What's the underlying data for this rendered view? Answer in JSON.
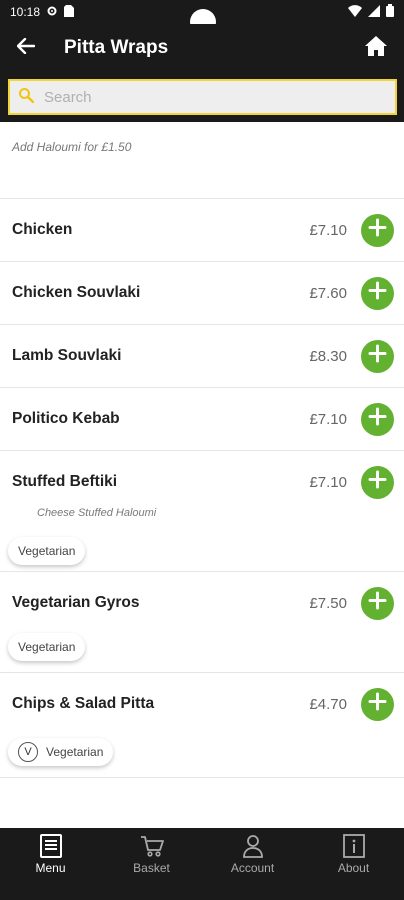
{
  "status": {
    "time": "10:18"
  },
  "header": {
    "title": "Pitta Wraps"
  },
  "search": {
    "placeholder": "Search"
  },
  "menu": {
    "note": "Add Haloumi for £1.50",
    "items": [
      {
        "name": "Chicken",
        "price": "£7.10"
      },
      {
        "name": "Chicken Souvlaki",
        "price": "£7.60"
      },
      {
        "name": "Lamb Souvlaki",
        "price": "£8.30"
      },
      {
        "name": "Politico Kebab",
        "price": "£7.10"
      },
      {
        "name": "Stuffed Beftiki",
        "price": "£7.10",
        "description": "Cheese Stuffed Haloumi",
        "tag": "Vegetarian"
      },
      {
        "name": "Vegetarian Gyros",
        "price": "£7.50",
        "tag": "Vegetarian"
      },
      {
        "name": "Chips & Salad Pitta",
        "price": "£4.70",
        "tag": "Vegetarian",
        "tag_icon": "V"
      }
    ]
  },
  "nav": {
    "items": [
      {
        "label": "Menu",
        "icon": "menu-book-icon",
        "active": true
      },
      {
        "label": "Basket",
        "icon": "basket-icon"
      },
      {
        "label": "Account",
        "icon": "account-icon"
      },
      {
        "label": "About",
        "icon": "about-icon"
      }
    ]
  },
  "colors": {
    "bar": "#1a1a1a",
    "accent_green": "#62b131",
    "search_border": "#f1d532"
  }
}
